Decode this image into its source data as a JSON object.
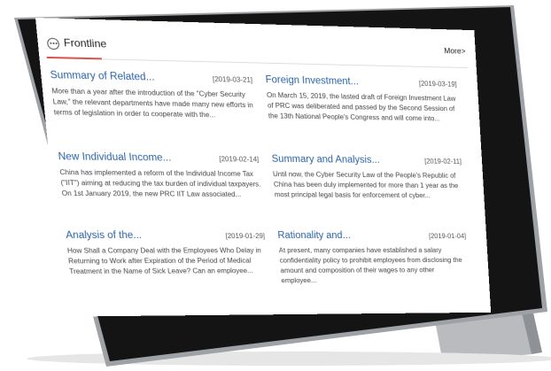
{
  "header": {
    "title": "Frontline",
    "more_label": "More>"
  },
  "articles": [
    {
      "title": "Summary of Related...",
      "date": "[2019-03-21]",
      "snippet": "More than a year after the introduction of the \"Cyber Security Law,\" the relevant departments have made many new efforts in terms of legislation in order to cooperate with the..."
    },
    {
      "title": "Foreign Investment...",
      "date": "[2019-03-19]",
      "snippet": "On March 15, 2019, the lasted draft of Foreign Investment Law of PRC was deliberated and passed by the Second Session of the 13th National People's Congress and will come into..."
    },
    {
      "title": "New Individual Income...",
      "date": "[2019-02-14]",
      "snippet": "China has implemented a reform of the Individual Income Tax (\"IIT\") aiming at reducing the tax burden of individual taxpayers. On 1st January 2019, the new PRC IIT Law associated..."
    },
    {
      "title": "Summary and Analysis...",
      "date": "[2019-02-11]",
      "snippet": "Until now, the Cyber Security Law of the People's Republic of China has been duly implemented for more than 1 year as the most principal legal basis for enforcement of cyber..."
    },
    {
      "title": "Analysis of the...",
      "date": "[2019-01-29]",
      "snippet": "How Shall a Company Deal with the Employees Who Delay in Returning to Work after Expiration of the Period of Medical Treatment in the Name of Sick Leave? Can an employee..."
    },
    {
      "title": "Rationality and...",
      "date": "[2019-01-04]",
      "snippet": "At present, many companies have established a salary confidentiality policy to prohibit employees from disclosing the amount and composition of their wages to any other employee..."
    }
  ]
}
